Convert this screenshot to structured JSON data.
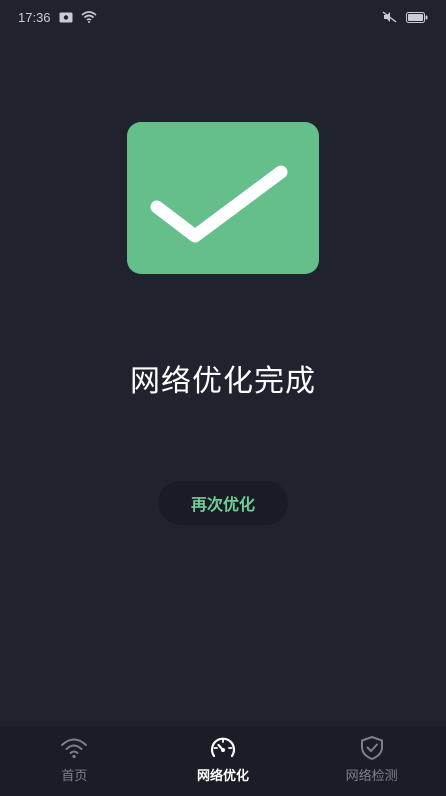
{
  "status_bar": {
    "time": "17:36",
    "icons": [
      "notification-icon",
      "wifi-icon",
      "mute-icon",
      "battery-icon"
    ]
  },
  "result": {
    "icon": "check-icon",
    "title": "网络优化完成",
    "accent_color": "#64bf8a"
  },
  "retry_button": {
    "label": "再次优化",
    "color": "#6fcf97"
  },
  "bottom_nav": {
    "items": [
      {
        "label": "首页",
        "icon": "wifi-icon",
        "active": false
      },
      {
        "label": "网络优化",
        "icon": "speedometer-icon",
        "active": true
      },
      {
        "label": "网络检测",
        "icon": "shield-check-icon",
        "active": false
      }
    ]
  }
}
